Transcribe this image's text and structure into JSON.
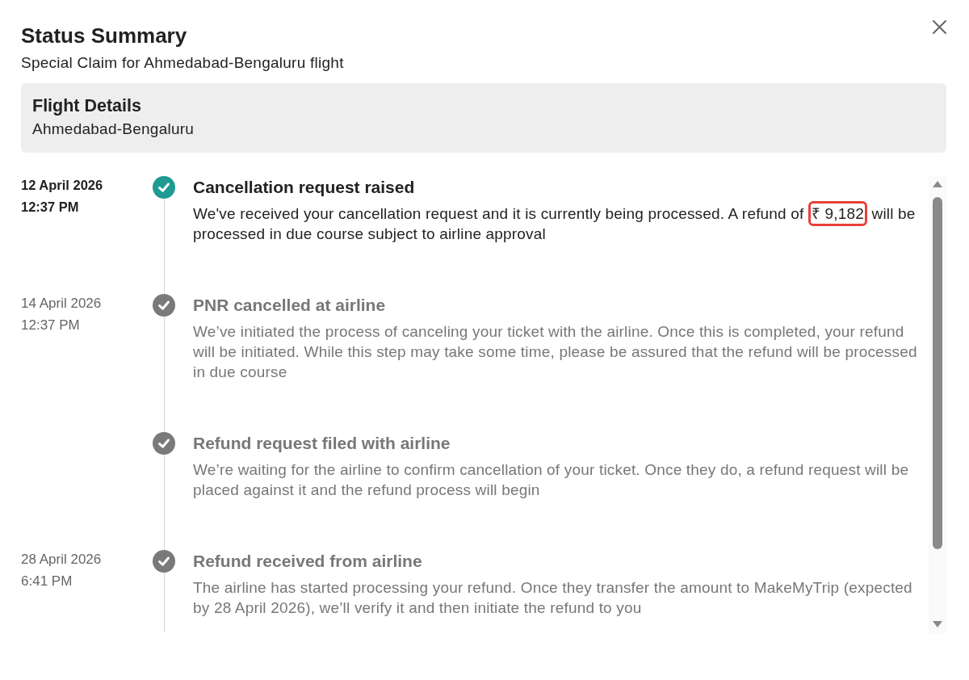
{
  "dialog": {
    "title": "Status Summary",
    "subtitle": "Special Claim for Ahmedabad-Bengaluru flight"
  },
  "flight_details": {
    "title": "Flight Details",
    "route": "Ahmedabad-Bengaluru"
  },
  "timeline": [
    {
      "date": "12 April 2026",
      "time": "12:37 PM",
      "title": "Cancellation request raised",
      "active": true,
      "description": [
        {
          "text": "We've received your cancellation request and it is currently being processed. A refund of",
          "highlighted": false
        },
        {
          "text": "₹ 9,182",
          "highlighted": true
        },
        {
          "text": "will be processed in due course subject to airline approval",
          "highlighted": false
        }
      ]
    },
    {
      "date": "14 April 2026",
      "time": "12:37 PM",
      "title": "PNR cancelled at airline",
      "active": false,
      "description": [
        {
          "text": "We’ve initiated the process of canceling your ticket with the airline. Once this is completed, your refund will be initiated. While this step may take some time, please be assured that the refund will be processed in due course",
          "highlighted": false
        }
      ]
    },
    {
      "title": "Refund request filed with airline",
      "active": false,
      "description": [
        {
          "text": "We’re waiting for the airline to confirm cancellation of your ticket. Once they do, a refund request will be placed against it and the refund process will begin",
          "highlighted": false
        }
      ]
    },
    {
      "date": "28 April 2026",
      "time": "6:41 PM",
      "title": "Refund received from airline",
      "active": false,
      "description": [
        {
          "text": "The airline has started processing your refund. Once they transfer the amount to MakeMyTrip (expected by 28 April 2026), we’ll verify it and then initiate the refund to you",
          "highlighted": false
        }
      ]
    }
  ]
}
